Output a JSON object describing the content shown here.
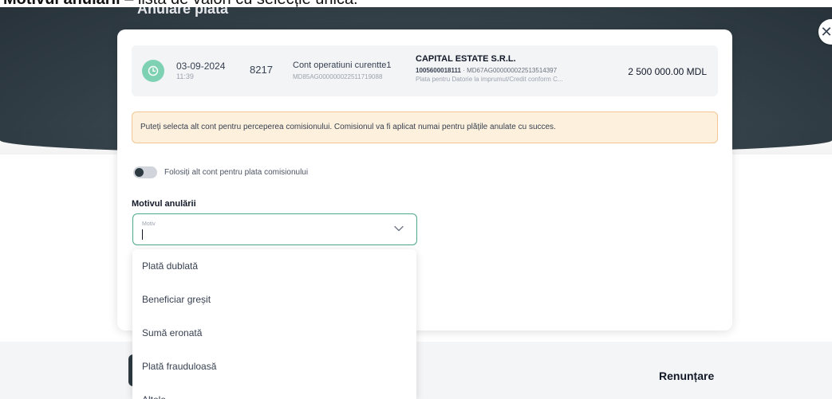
{
  "caption": {
    "bold_part": "Motivul anulării",
    "rest": " – lista de valori cu selecție unică."
  },
  "page": {
    "title": "Anulare plată",
    "cancel_label": "Renunțare"
  },
  "payment": {
    "date": "03-09-2024",
    "time": "11:39",
    "number": "8217",
    "account_name": "Cont operatiuni curentte1",
    "account_iban": "MD85AG000000022511719088",
    "beneficiary_name": "CAPITAL ESTATE S.R.L.",
    "beneficiary_code": "1005600018111",
    "beneficiary_iban": " · MD67AG000000022513514397",
    "purpose": "Plata pentru Datorie la imprumut/Credit conform C...",
    "amount": "2 500 000.00 MDL"
  },
  "info_banner": {
    "text": "Puteți selecta alt cont pentru perceperea comisionului. Comisionul va fi aplicat numai pentru plățile anulate cu succes."
  },
  "toggle": {
    "label": "Folosiți alt cont pentru plata comisionului",
    "on": false
  },
  "reason": {
    "label": "Motivul anulării",
    "field_label": "Motiv",
    "value": ""
  },
  "dropdown": {
    "options": [
      "Plată dublată",
      "Beneficiar greșit",
      "Sumă eronată",
      "Plată frauduloasă",
      "Altele"
    ]
  },
  "colors": {
    "accent_green": "#4ea88a",
    "status_icon": "#7fd1b4",
    "banner_bg": "#fdf0dc",
    "banner_border": "#efc893",
    "dark_header": "#2d3a42"
  },
  "icons": {
    "status": "clock-icon",
    "close": "close-icon",
    "chevron": "chevron-down-icon"
  }
}
